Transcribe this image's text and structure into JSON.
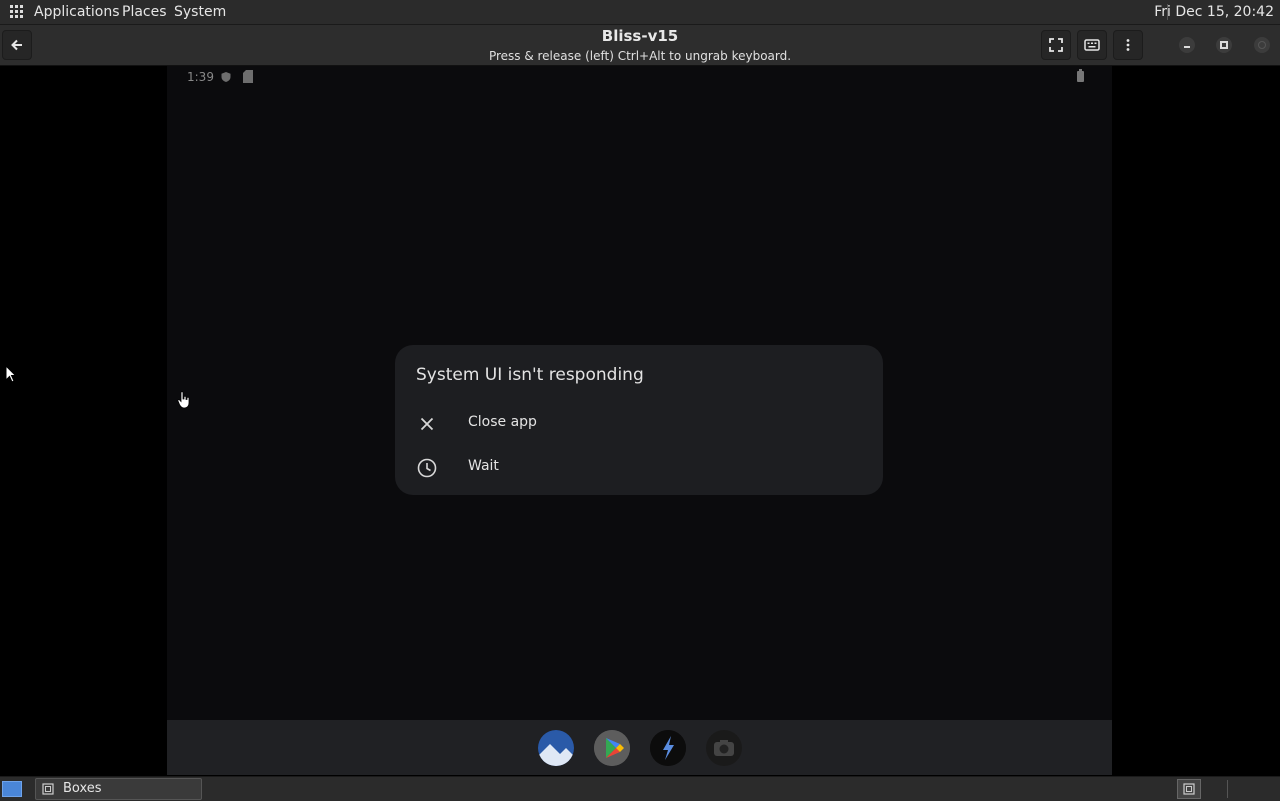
{
  "top_panel": {
    "menus": [
      "Applications",
      "Places",
      "System"
    ],
    "clock": "Fri Dec 15, 20:42"
  },
  "headerbar": {
    "title": "Bliss-v15",
    "subtitle": "Press & release (left) Ctrl+Alt to ungrab keyboard."
  },
  "vm": {
    "status_time": "1:39",
    "dialog": {
      "title": "System UI isn't responding",
      "options": [
        {
          "label": "Close app",
          "icon": "close-icon"
        },
        {
          "label": "Wait",
          "icon": "clock-icon"
        }
      ]
    },
    "dock_apps": [
      "gallery-app",
      "play-store-app",
      "bolt-app",
      "camera-app"
    ]
  },
  "taskbar": {
    "task_label": "Boxes"
  },
  "colors": {
    "panel": "#2b2b2b",
    "vm_background": "#0b0b0d",
    "dialog": "#1d1e21",
    "dock": "#202124"
  }
}
